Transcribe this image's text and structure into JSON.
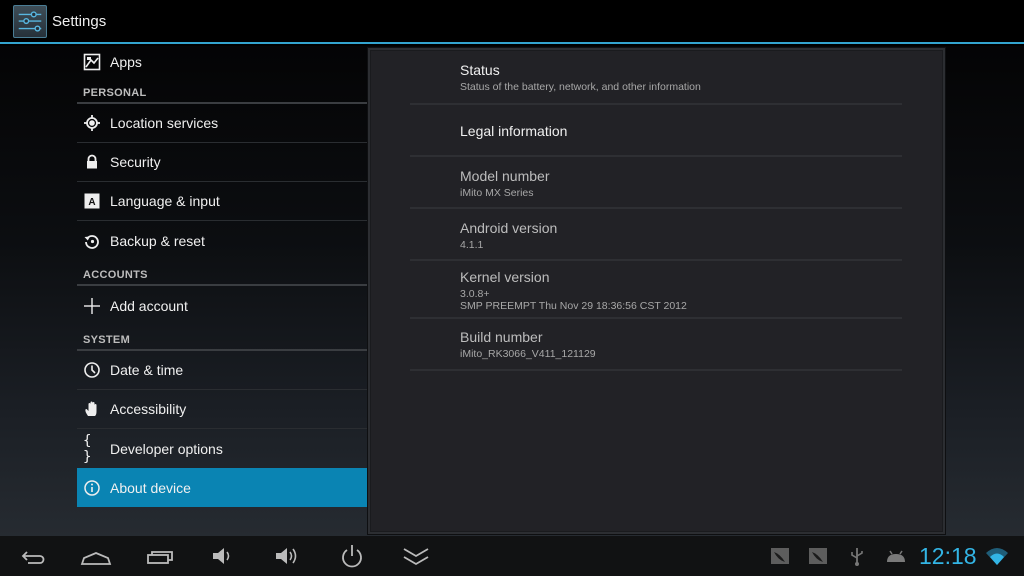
{
  "actionbar": {
    "title": "Settings",
    "icon": "settings-sliders-icon"
  },
  "sidebar": {
    "top_items": [
      {
        "label": "Apps",
        "icon": "apps-icon"
      }
    ],
    "sections": [
      {
        "header": "PERSONAL",
        "items": [
          {
            "label": "Location services",
            "icon": "location-icon"
          },
          {
            "label": "Security",
            "icon": "lock-icon"
          },
          {
            "label": "Language & input",
            "icon": "keyboard-a-icon"
          },
          {
            "label": "Backup & reset",
            "icon": "backup-restore-icon"
          }
        ]
      },
      {
        "header": "ACCOUNTS",
        "items": [
          {
            "label": "Add account",
            "icon": "plus-icon"
          }
        ]
      },
      {
        "header": "SYSTEM",
        "items": [
          {
            "label": "Date & time",
            "icon": "clock-icon"
          },
          {
            "label": "Accessibility",
            "icon": "hand-icon"
          },
          {
            "label": "Developer options",
            "icon": "braces-icon",
            "glyph": "{ }"
          },
          {
            "label": "About device",
            "icon": "info-icon",
            "selected": true
          }
        ]
      }
    ]
  },
  "about": {
    "items": [
      {
        "title": "Status",
        "summary": "Status of the battery, network, and other information"
      },
      {
        "title": "Legal information"
      },
      {
        "title": "Model number",
        "summary": "iMito MX Series"
      },
      {
        "title": "Android version",
        "summary": "4.1.1"
      },
      {
        "title": "Kernel version",
        "summary": "3.0.8+",
        "summary2": "SMP PREEMPT Thu Nov 29 18:36:56 CST 2012"
      },
      {
        "title": "Build number",
        "summary": "iMito_RK3066_V411_121129"
      }
    ]
  },
  "systembar": {
    "nav_buttons": [
      "back",
      "home",
      "recent-apps",
      "volume-down",
      "volume-up",
      "power",
      "hide-bar"
    ],
    "status_icons": [
      "notification-app-icon",
      "notification-app-icon",
      "usb-icon",
      "android-debug-icon"
    ],
    "clock": "12:18",
    "wifi": "wifi-icon"
  },
  "colors": {
    "accent": "#33b5e5",
    "selected": "#0a84b3",
    "divider": "#33a4cf"
  }
}
